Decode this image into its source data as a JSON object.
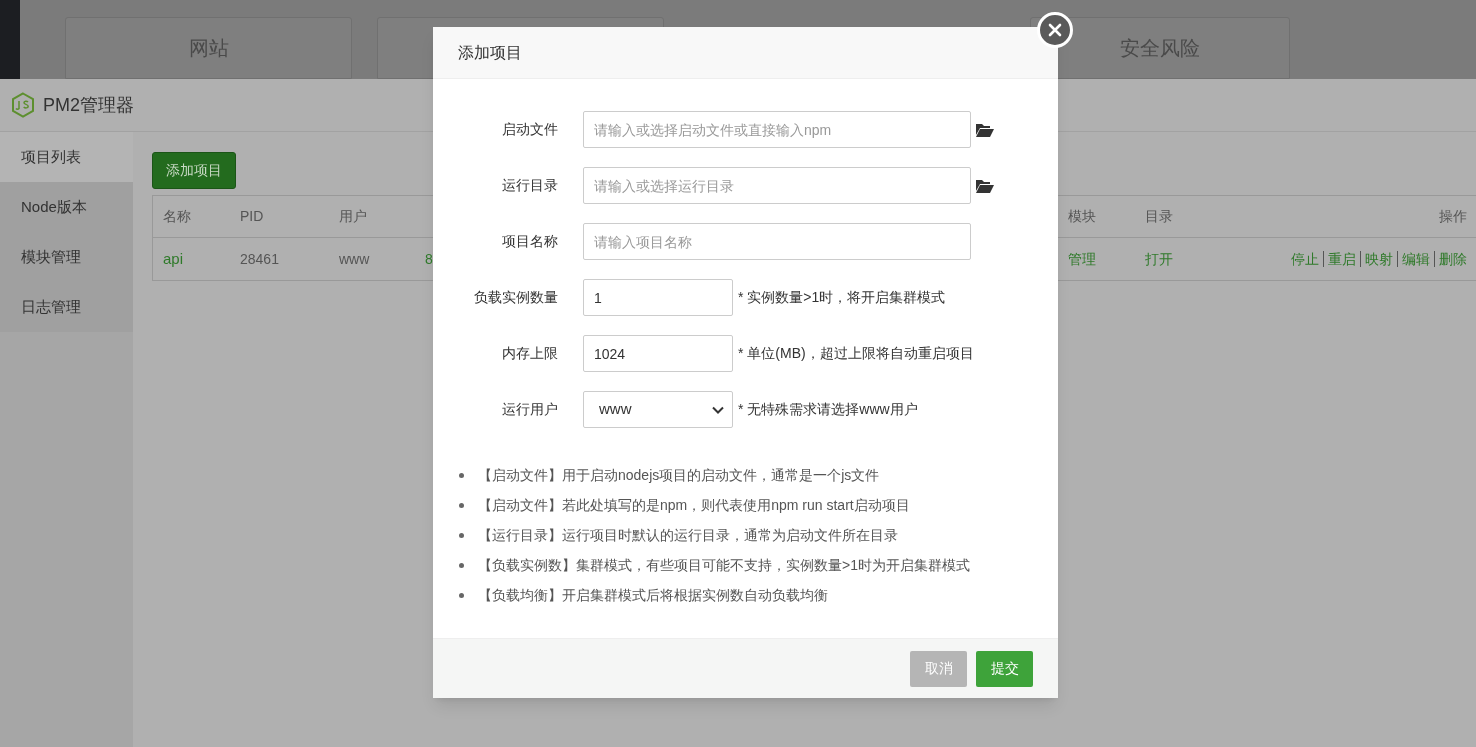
{
  "background_cards": [
    {
      "kind": "labeled",
      "label": "网站"
    },
    {
      "kind": "blank"
    },
    {
      "kind": "labeled",
      "label": "安全风险"
    }
  ],
  "panel": {
    "title": "PM2管理器",
    "sidebar": [
      {
        "label": "项目列表",
        "selected": true
      },
      {
        "label": "Node版本",
        "selected": false
      },
      {
        "label": "模块管理",
        "selected": false
      },
      {
        "label": "日志管理",
        "selected": false
      }
    ],
    "add_button": "添加项目",
    "table": {
      "columns_left": [
        "名称",
        "PID",
        "用户"
      ],
      "columns_right": [
        "模块",
        "目录",
        "操作"
      ],
      "row": {
        "left": [
          {
            "kind": "link",
            "text": "api"
          },
          {
            "kind": "text",
            "text": "28461"
          },
          {
            "kind": "text",
            "text": "www"
          },
          {
            "kind": "link",
            "text": "8"
          }
        ],
        "right": [
          {
            "kind": "link",
            "text": "管理"
          },
          {
            "kind": "link",
            "text": "打开"
          }
        ],
        "actions": [
          "停止",
          "重启",
          "映射",
          "编辑",
          "删除"
        ]
      }
    }
  },
  "dialog": {
    "title": "添加项目",
    "fields": [
      {
        "kind": "text",
        "label": "启动文件",
        "placeholder": "请输入或选择启动文件或直接输入npm",
        "wide": true,
        "browse": true
      },
      {
        "kind": "text",
        "label": "运行目录",
        "placeholder": "请输入或选择运行目录",
        "wide": true,
        "browse": true
      },
      {
        "kind": "text",
        "label": "项目名称",
        "placeholder": "请输入项目名称",
        "wide": true,
        "browse": false
      },
      {
        "kind": "text",
        "label": "负载实例数量",
        "value": "1",
        "wide": false,
        "browse": false,
        "hint": "* 实例数量>1时，将开启集群模式"
      },
      {
        "kind": "text",
        "label": "内存上限",
        "value": "1024",
        "wide": false,
        "browse": false,
        "hint": "* 单位(MB)，超过上限将自动重启项目"
      },
      {
        "kind": "select",
        "label": "运行用户",
        "value": "www",
        "wide": false,
        "browse": false,
        "hint": "* 无特殊需求请选择www用户"
      }
    ],
    "notes": [
      "【启动文件】用于启动nodejs项目的启动文件，通常是一个js文件",
      "【启动文件】若此处填写的是npm，则代表使用npm run start启动项目",
      "【运行目录】运行项目时默认的运行目录，通常为启动文件所在目录",
      "【负载实例数】集群模式，有些项目可能不支持，实例数量>1时为开启集群模式",
      "【负载均衡】开启集群模式后将根据实例数自动负载均衡"
    ],
    "buttons": [
      {
        "kind": "cancel",
        "label": "取消"
      },
      {
        "kind": "submit",
        "label": "提交"
      }
    ]
  }
}
